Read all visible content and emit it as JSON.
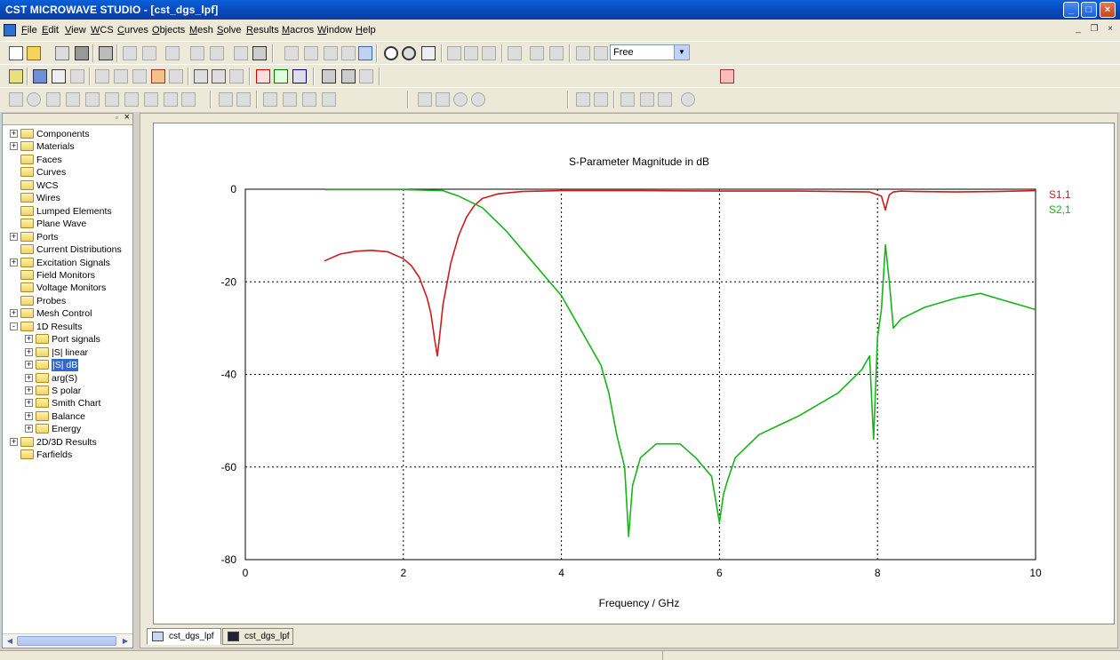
{
  "window": {
    "title": "CST MICROWAVE STUDIO  - [cst_dgs_lpf]"
  },
  "menu": [
    "File",
    "Edit",
    "View",
    "WCS",
    "Curves",
    "Objects",
    "Mesh",
    "Solve",
    "Results",
    "Macros",
    "Window",
    "Help"
  ],
  "toolbar": {
    "mode_select": "Free"
  },
  "tree": {
    "items": [
      {
        "label": "Components",
        "level": 0,
        "expand": "+"
      },
      {
        "label": "Materials",
        "level": 0,
        "expand": "+"
      },
      {
        "label": "Faces",
        "level": 0,
        "expand": ""
      },
      {
        "label": "Curves",
        "level": 0,
        "expand": ""
      },
      {
        "label": "WCS",
        "level": 0,
        "expand": ""
      },
      {
        "label": "Wires",
        "level": 0,
        "expand": ""
      },
      {
        "label": "Lumped Elements",
        "level": 0,
        "expand": ""
      },
      {
        "label": "Plane Wave",
        "level": 0,
        "expand": ""
      },
      {
        "label": "Ports",
        "level": 0,
        "expand": "+"
      },
      {
        "label": "Current Distributions",
        "level": 0,
        "expand": ""
      },
      {
        "label": "Excitation Signals",
        "level": 0,
        "expand": "+"
      },
      {
        "label": "Field Monitors",
        "level": 0,
        "expand": ""
      },
      {
        "label": "Voltage Monitors",
        "level": 0,
        "expand": ""
      },
      {
        "label": "Probes",
        "level": 0,
        "expand": ""
      },
      {
        "label": "Mesh Control",
        "level": 0,
        "expand": "+"
      },
      {
        "label": "1D Results",
        "level": 0,
        "expand": "-"
      },
      {
        "label": "Port signals",
        "level": 1,
        "expand": "+"
      },
      {
        "label": "|S| linear",
        "level": 1,
        "expand": "+"
      },
      {
        "label": "|S| dB",
        "level": 1,
        "expand": "+",
        "selected": true
      },
      {
        "label": "arg(S)",
        "level": 1,
        "expand": "+"
      },
      {
        "label": "S polar",
        "level": 1,
        "expand": "+"
      },
      {
        "label": "Smith Chart",
        "level": 1,
        "expand": "+"
      },
      {
        "label": "Balance",
        "level": 1,
        "expand": "+"
      },
      {
        "label": "Energy",
        "level": 1,
        "expand": "+"
      },
      {
        "label": "2D/3D Results",
        "level": 0,
        "expand": "+"
      },
      {
        "label": "Farfields",
        "level": 0,
        "expand": ""
      }
    ]
  },
  "tabs": [
    {
      "label": "cst_dgs_lpf"
    },
    {
      "label": "cst_dgs_lpf"
    }
  ],
  "colors": {
    "s11": "#c81e1e",
    "s21": "#18b418",
    "titlebar": "#0a5fd8"
  },
  "chart_data": {
    "type": "line",
    "title": "S-Parameter Magnitude in dB",
    "xlabel": "Frequency / GHz",
    "ylabel": "",
    "xlim": [
      0,
      10
    ],
    "ylim": [
      -80,
      0
    ],
    "xticks": [
      "0",
      "2",
      "4",
      "6",
      "8",
      "10"
    ],
    "yticks": [
      "0",
      "-20",
      "-40",
      "-60",
      "-80"
    ],
    "grid": true,
    "legend_position": "right",
    "series": [
      {
        "name": "S1,1",
        "color": "#c81e1e",
        "x": [
          1.0,
          1.2,
          1.4,
          1.6,
          1.8,
          2.0,
          2.1,
          2.2,
          2.3,
          2.35,
          2.4,
          2.43,
          2.47,
          2.5,
          2.6,
          2.7,
          2.8,
          2.9,
          3.0,
          3.2,
          3.5,
          4.0,
          5.0,
          6.0,
          7.0,
          7.5,
          7.9,
          8.05,
          8.1,
          8.12,
          8.15,
          8.2,
          8.3,
          8.5,
          9.0,
          9.5,
          10.0
        ],
        "y": [
          -15.5,
          -14.0,
          -13.4,
          -13.2,
          -13.5,
          -15.0,
          -16.5,
          -19.0,
          -23.5,
          -27.0,
          -33.0,
          -36.0,
          -30.0,
          -25.0,
          -16.0,
          -10.0,
          -6.0,
          -3.5,
          -2.0,
          -1.0,
          -0.5,
          -0.3,
          -0.3,
          -0.4,
          -0.4,
          -0.5,
          -0.6,
          -1.5,
          -4.5,
          -3.0,
          -1.2,
          -0.6,
          -0.4,
          -0.5,
          -0.6,
          -0.5,
          -0.3
        ]
      },
      {
        "name": "S2,1",
        "color": "#18b418",
        "x": [
          1.0,
          1.5,
          2.0,
          2.5,
          2.7,
          3.0,
          3.3,
          3.6,
          4.0,
          4.3,
          4.5,
          4.6,
          4.7,
          4.8,
          4.85,
          4.9,
          5.0,
          5.2,
          5.5,
          5.7,
          5.9,
          6.0,
          6.05,
          6.1,
          6.2,
          6.5,
          7.0,
          7.5,
          7.8,
          7.9,
          7.95,
          8.0,
          8.05,
          8.1,
          8.15,
          8.2,
          8.3,
          8.6,
          9.0,
          9.3,
          9.6,
          10.0
        ],
        "y": [
          -0.1,
          -0.1,
          -0.1,
          -0.3,
          -1.5,
          -4.0,
          -9.0,
          -15.0,
          -23.0,
          -32.0,
          -38.0,
          -44.0,
          -53.0,
          -60.0,
          -75.0,
          -64.0,
          -58.0,
          -55.0,
          -55.0,
          -58.0,
          -62.0,
          -72.0,
          -66.0,
          -63.0,
          -58.0,
          -53.0,
          -49.0,
          -44.0,
          -39.0,
          -36.0,
          -54.0,
          -32.0,
          -26.0,
          -12.0,
          -20.0,
          -30.0,
          -28.0,
          -25.5,
          -23.5,
          -22.5,
          -24.0,
          -26.0
        ]
      }
    ]
  }
}
